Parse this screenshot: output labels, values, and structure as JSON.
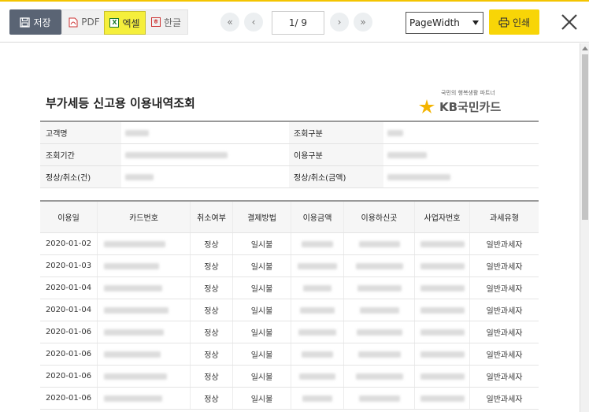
{
  "toolbar": {
    "save_label": "저장",
    "pdf_label": "PDF",
    "excel_label": "엑셀",
    "hwp_label": "한글",
    "page_indicator": "1/ 9",
    "zoom_value": "PageWidth",
    "print_label": "인쇄",
    "icons": {
      "save": "floppy-disk-icon",
      "pdf": "pdf-file-icon",
      "excel": "excel-file-icon",
      "hwp": "hwp-file-icon",
      "first": "double-chevron-left-icon",
      "prev": "chevron-left-icon",
      "next": "chevron-right-icon",
      "last": "double-chevron-right-icon",
      "print": "printer-icon",
      "close": "close-icon"
    },
    "colors": {
      "save_bg": "#5a6474",
      "excel_bg": "#f5ef3c",
      "print_bg": "#f8d507",
      "accent_line": "#f4c400"
    }
  },
  "document": {
    "title": "부가세등 신고용 이용내역조회",
    "logo": {
      "tagline": "국민의 행복생활 파트너",
      "brand": "KB국민카드"
    },
    "info": {
      "rows": [
        {
          "label1": "고객명",
          "label2": "조회구분"
        },
        {
          "label1": "조회기간",
          "label2": "이용구분"
        },
        {
          "label1": "정상/취소(건)",
          "label2": "정상/취소(금액)"
        }
      ]
    },
    "transactions": {
      "headers": [
        "이용일",
        "카드번호",
        "취소여부",
        "결제방법",
        "이용금액",
        "이용하신곳",
        "사업자번호",
        "과세유형"
      ],
      "rows": [
        {
          "date": "2020-01-02",
          "cancel": "정상",
          "payment": "일시불",
          "tax_type": "일반과세자"
        },
        {
          "date": "2020-01-03",
          "cancel": "정상",
          "payment": "일시불",
          "tax_type": "일반과세자"
        },
        {
          "date": "2020-01-04",
          "cancel": "정상",
          "payment": "일시불",
          "tax_type": "일반과세자"
        },
        {
          "date": "2020-01-04",
          "cancel": "정상",
          "payment": "일시불",
          "tax_type": "일반과세자"
        },
        {
          "date": "2020-01-06",
          "cancel": "정상",
          "payment": "일시불",
          "tax_type": "일반과세자"
        },
        {
          "date": "2020-01-06",
          "cancel": "정상",
          "payment": "일시불",
          "tax_type": "일반과세자"
        },
        {
          "date": "2020-01-06",
          "cancel": "정상",
          "payment": "일시불",
          "tax_type": "일반과세자"
        },
        {
          "date": "2020-01-06",
          "cancel": "정상",
          "payment": "일시불",
          "tax_type": "일반과세자"
        }
      ]
    }
  }
}
